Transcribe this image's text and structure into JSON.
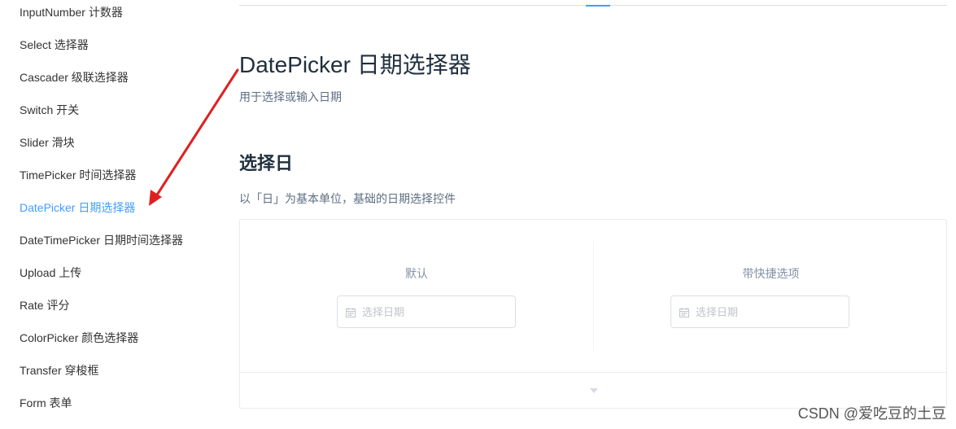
{
  "sidebar": {
    "items": [
      {
        "label": "InputNumber 计数器"
      },
      {
        "label": "Select 选择器"
      },
      {
        "label": "Cascader 级联选择器"
      },
      {
        "label": "Switch 开关"
      },
      {
        "label": "Slider 滑块"
      },
      {
        "label": "TimePicker 时间选择器"
      },
      {
        "label": "DatePicker 日期选择器",
        "active": true
      },
      {
        "label": "DateTimePicker 日期时间选择器"
      },
      {
        "label": "Upload 上传"
      },
      {
        "label": "Rate 评分"
      },
      {
        "label": "ColorPicker 颜色选择器"
      },
      {
        "label": "Transfer 穿梭框"
      },
      {
        "label": "Form 表单"
      }
    ]
  },
  "main": {
    "title": "DatePicker 日期选择器",
    "description": "用于选择或输入日期",
    "section_title": "选择日",
    "section_description": "以「日」为基本单位，基础的日期选择控件",
    "demo": {
      "left_label": "默认",
      "left_placeholder": "选择日期",
      "right_label": "带快捷选项",
      "right_placeholder": "选择日期"
    }
  },
  "annotation": {
    "arrow_color": "#e02020"
  },
  "watermark": "CSDN @爱吃豆的土豆",
  "colors": {
    "accent": "#409eff",
    "text": "#1f2f3d",
    "muted": "#5e6d82"
  }
}
